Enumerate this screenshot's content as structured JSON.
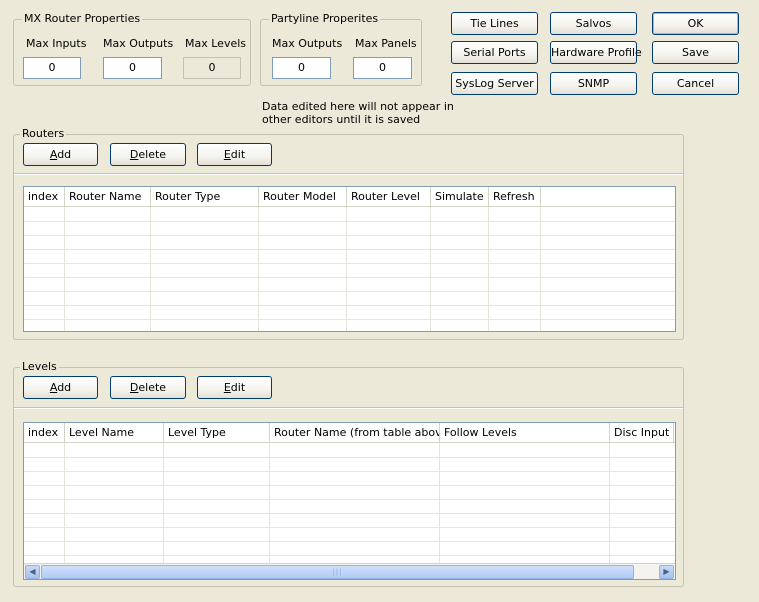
{
  "mx_router_properties": {
    "title": "MX Router Properties",
    "max_inputs_label": "Max Inputs",
    "max_inputs_value": "0",
    "max_outputs_label": "Max Outputs",
    "max_outputs_value": "0",
    "max_levels_label": "Max Levels",
    "max_levels_value": "0"
  },
  "partyline_properties": {
    "title": "Partyline Properites",
    "max_outputs_label": "Max Outputs",
    "max_outputs_value": "0",
    "max_panels_label": "Max Panels",
    "max_panels_value": "0"
  },
  "notice": {
    "line1": "Data edited here will not appear in",
    "line2": "other editors until it is saved"
  },
  "toolbar": {
    "tie_lines": "Tie Lines",
    "salvos": "Salvos",
    "serial_ports": "Serial Ports",
    "hardware_profile": "Hardware Profile",
    "syslog_server": "SysLog Server",
    "snmp": "SNMP"
  },
  "dialog": {
    "ok": "OK",
    "save": "Save",
    "cancel": "Cancel"
  },
  "routers": {
    "title": "Routers",
    "add": "Add",
    "delete": "Delete",
    "edit": "Edit",
    "columns": [
      "index",
      "Router Name",
      "Router Type",
      "Router Model",
      "Router Level",
      "Simulate",
      "Refresh"
    ]
  },
  "levels": {
    "title": "Levels",
    "add": "Add",
    "delete": "Delete",
    "edit": "Edit",
    "columns": [
      "index",
      "Level Name",
      "Level Type",
      "Router Name (from table above)",
      "Follow Levels",
      "Disc Input"
    ]
  },
  "scrollbar": {
    "grip": "|||"
  },
  "icons": {
    "scroll_left": "scroll-left-arrow-icon",
    "scroll_right": "scroll-right-arrow-icon"
  }
}
